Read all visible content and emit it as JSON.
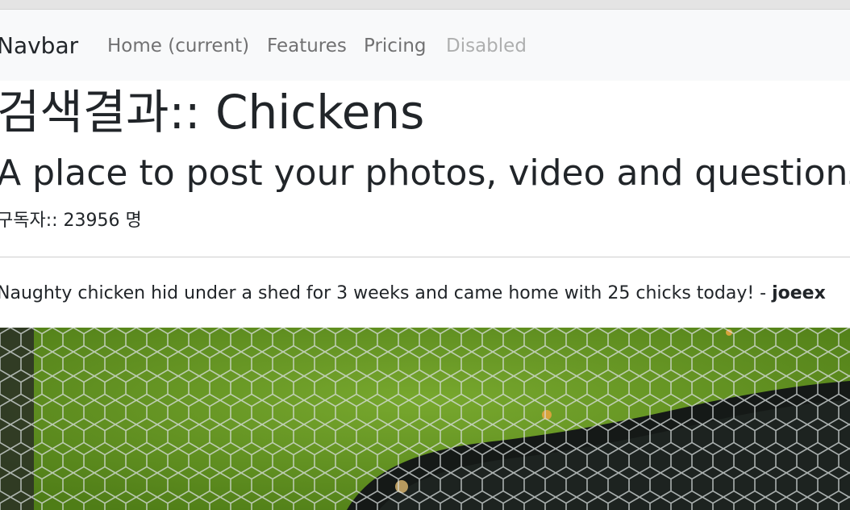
{
  "navbar": {
    "brand": "Navbar",
    "links": [
      {
        "label": "Home (current)"
      },
      {
        "label": "Features"
      },
      {
        "label": "Pricing"
      },
      {
        "label": "Disabled"
      }
    ]
  },
  "header": {
    "title": "검색결과:: Chickens",
    "subtitle": "A place to post your photos, video and questions",
    "subscribers": "구독자:: 23956 명"
  },
  "post": {
    "title": "Naughty chicken hid under a shed for 3 weeks and came home with 25 chicks today!",
    "separator": " - ",
    "author": "joeex"
  }
}
